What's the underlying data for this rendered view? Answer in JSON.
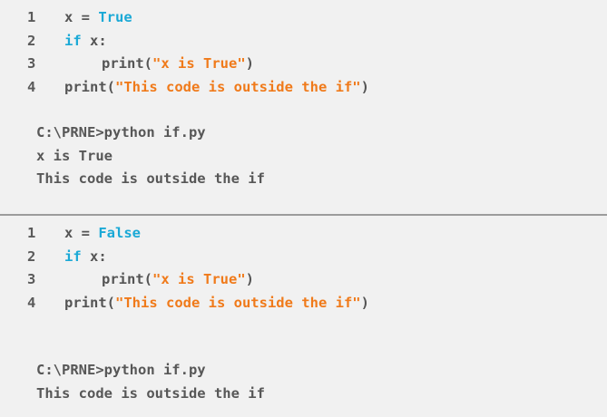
{
  "examples": [
    {
      "code": [
        {
          "num": "1",
          "parts": [
            {
              "t": "x = ",
              "c": "txt"
            },
            {
              "t": "True",
              "c": "kw"
            }
          ],
          "indent": 0
        },
        {
          "num": "2",
          "parts": [
            {
              "t": "if",
              "c": "kw"
            },
            {
              "t": " x:",
              "c": "txt"
            }
          ],
          "indent": 0
        },
        {
          "num": "3",
          "parts": [
            {
              "t": "print(",
              "c": "txt"
            },
            {
              "t": "\"x is True\"",
              "c": "str"
            },
            {
              "t": ")",
              "c": "txt"
            }
          ],
          "indent": 1
        },
        {
          "num": "4",
          "parts": [
            {
              "t": "print(",
              "c": "txt"
            },
            {
              "t": "\"This code is outside the if\"",
              "c": "str"
            },
            {
              "t": ")",
              "c": "txt"
            }
          ],
          "indent": 0
        }
      ],
      "output": [
        "C:\\PRNE>python if.py",
        "x is True",
        "This code is outside the if"
      ]
    },
    {
      "code": [
        {
          "num": "1",
          "parts": [
            {
              "t": "x = ",
              "c": "txt"
            },
            {
              "t": "False",
              "c": "kw"
            }
          ],
          "indent": 0
        },
        {
          "num": "2",
          "parts": [
            {
              "t": "if",
              "c": "kw"
            },
            {
              "t": " x:",
              "c": "txt"
            }
          ],
          "indent": 0
        },
        {
          "num": "3",
          "parts": [
            {
              "t": "print(",
              "c": "txt"
            },
            {
              "t": "\"x is True\"",
              "c": "str"
            },
            {
              "t": ")",
              "c": "txt"
            }
          ],
          "indent": 1
        },
        {
          "num": "4",
          "parts": [
            {
              "t": "print(",
              "c": "txt"
            },
            {
              "t": "\"This code is outside the if\"",
              "c": "str"
            },
            {
              "t": ")",
              "c": "txt"
            }
          ],
          "indent": 0
        }
      ],
      "output": [
        "C:\\PRNE>python if.py",
        "This code is outside the if"
      ]
    }
  ],
  "colors": {
    "keyword": "#1ba9d6",
    "string": "#f07a1a",
    "text": "#555555",
    "background": "#f1f1f1",
    "divider": "#9c9c9c"
  }
}
